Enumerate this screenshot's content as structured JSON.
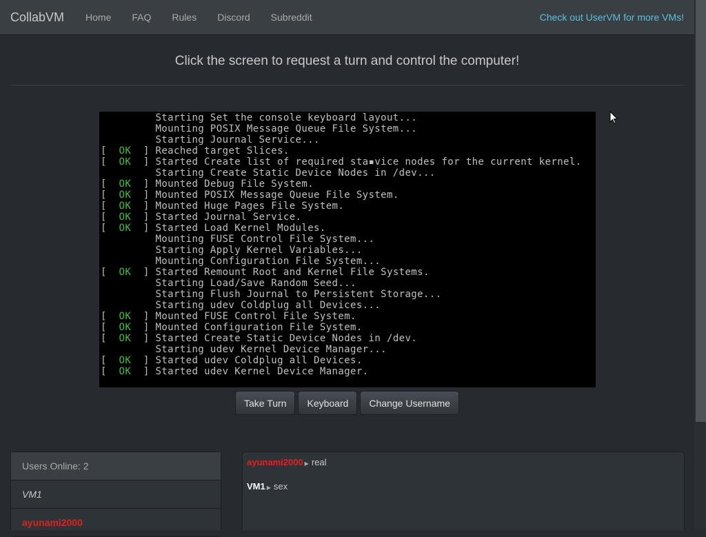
{
  "nav": {
    "brand": "CollabVM",
    "links": [
      "Home",
      "FAQ",
      "Rules",
      "Discord",
      "Subreddit"
    ],
    "right_link": "Check out UserVM for more VMs!"
  },
  "header": {
    "text": "Click the screen to request a turn and control the computer!"
  },
  "console": {
    "ok_text": "OK",
    "lines": [
      {
        "ok": false,
        "text": "Starting Set the console keyboard layout..."
      },
      {
        "ok": false,
        "text": "Mounting POSIX Message Queue File System..."
      },
      {
        "ok": false,
        "text": "Starting Journal Service..."
      },
      {
        "ok": true,
        "text": "Reached target Slices."
      },
      {
        "ok": true,
        "text": "Started Create list of required sta▪vice nodes for the current kernel."
      },
      {
        "ok": false,
        "text": "Starting Create Static Device Nodes in /dev..."
      },
      {
        "ok": true,
        "text": "Mounted Debug File System."
      },
      {
        "ok": true,
        "text": "Mounted POSIX Message Queue File System."
      },
      {
        "ok": true,
        "text": "Mounted Huge Pages File System."
      },
      {
        "ok": true,
        "text": "Started Journal Service."
      },
      {
        "ok": true,
        "text": "Started Load Kernel Modules."
      },
      {
        "ok": false,
        "text": "Mounting FUSE Control File System..."
      },
      {
        "ok": false,
        "text": "Starting Apply Kernel Variables..."
      },
      {
        "ok": false,
        "text": "Mounting Configuration File System..."
      },
      {
        "ok": true,
        "text": "Started Remount Root and Kernel File Systems."
      },
      {
        "ok": false,
        "text": "Starting Load/Save Random Seed..."
      },
      {
        "ok": false,
        "text": "Starting Flush Journal to Persistent Storage..."
      },
      {
        "ok": false,
        "text": "Starting udev Coldplug all Devices..."
      },
      {
        "ok": true,
        "text": "Mounted FUSE Control File System."
      },
      {
        "ok": true,
        "text": "Mounted Configuration File System."
      },
      {
        "ok": true,
        "text": "Started Create Static Device Nodes in /dev."
      },
      {
        "ok": false,
        "text": "Starting udev Kernel Device Manager..."
      },
      {
        "ok": true,
        "text": "Started udev Coldplug all Devices."
      },
      {
        "ok": true,
        "text": "Started udev Kernel Device Manager."
      }
    ]
  },
  "buttons": {
    "take_turn": "Take Turn",
    "keyboard": "Keyboard",
    "change_username": "Change Username"
  },
  "users": {
    "header": "Users Online: 2",
    "list": [
      {
        "name": "VM1",
        "color": "#c8c8c8"
      },
      {
        "name": "ayunami2000",
        "color": "#e0211d"
      }
    ]
  },
  "chat": {
    "messages": [
      {
        "user": "ayunami2000",
        "color": "#e0211d",
        "text": "real"
      },
      {
        "user": "VM1",
        "color": "#ffffff",
        "text": "sex"
      }
    ]
  },
  "colors": {
    "ok_green": "#3fbf3f",
    "link_blue": "#5bc0de",
    "admin_red": "#e0211d"
  },
  "icons": {
    "mouse": "mouse-pointer-icon",
    "message_arrow": "triangle-right-icon"
  }
}
